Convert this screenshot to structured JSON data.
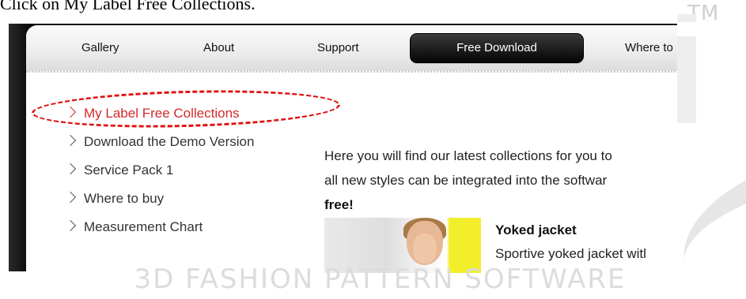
{
  "instruction": "Click on My Label Free Collections.",
  "watermark": {
    "trademark": "TM",
    "brand": "3D FASHION PATTERN SOFTWARE"
  },
  "navbar": {
    "items": [
      {
        "label": "Gallery"
      },
      {
        "label": "About"
      },
      {
        "label": "Support"
      },
      {
        "label": "Free Download",
        "active": true
      },
      {
        "label": "Where to"
      }
    ]
  },
  "sidebar": {
    "items": [
      {
        "label": "My Label Free Collections",
        "active": true
      },
      {
        "label": "Download the Demo Version"
      },
      {
        "label": "Service Pack 1"
      },
      {
        "label": "Where to buy"
      },
      {
        "label": "Measurement Chart"
      }
    ]
  },
  "content": {
    "intro_line1": "Here you will find our latest collections for you to",
    "intro_line2": "all new styles can be integrated into the softwar",
    "intro_bold": "free!",
    "product": {
      "title": "Yoked jacket",
      "description": "Sportive yoked jacket witl"
    }
  },
  "colors": {
    "highlight": "#e01010",
    "active_link": "#d12a2a",
    "nav_active_bg": "#111111"
  },
  "icons": [
    "chevron-right-icon"
  ]
}
